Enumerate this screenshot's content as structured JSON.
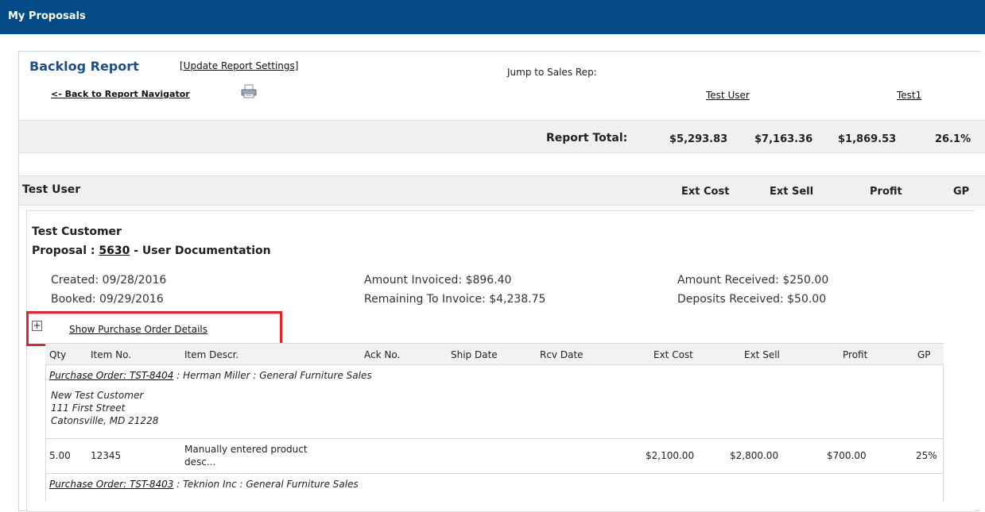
{
  "header": {
    "title": "My Proposals"
  },
  "report": {
    "title": "Backlog Report",
    "update_settings": "[Update Report Settings]",
    "back_link": "<- Back to Report Navigator",
    "jump_label": "Jump to Sales Rep:",
    "reps": [
      "Test User",
      "Test1"
    ],
    "total_label": "Report Total:",
    "totals": [
      "$5,293.83",
      "$7,163.36",
      "$1,869.53",
      "26.1%"
    ]
  },
  "user_section": {
    "name": "Test User",
    "columns": [
      "Ext Cost",
      "Ext Sell",
      "Profit",
      "GP"
    ]
  },
  "customer": {
    "name": "Test Customer",
    "proposal_prefix": "Proposal : ",
    "proposal_number": "5630",
    "proposal_suffix": " - User Documentation",
    "created": "Created: 09/28/2016",
    "booked": "Booked: 09/29/2016",
    "amount_invoiced": "Amount Invoiced: $896.40",
    "remaining_to_invoice": "Remaining To Invoice: $4,238.75",
    "amount_received": "Amount Received: $250.00",
    "deposits_received": "Deposits Received: $50.00",
    "show_po_details": "Show Purchase Order Details"
  },
  "po_table": {
    "headers": [
      "Qty",
      "Item No.",
      "Item Descr.",
      "Ack No.",
      "Ship Date",
      "Rcv Date",
      "Ext Cost",
      "Ext Sell",
      "Profit",
      "GP"
    ],
    "po1": {
      "link": "Purchase Order: TST-8404",
      "rest": " : Herman Miller : General Furniture Sales",
      "address": [
        "New Test Customer",
        "111 First Street",
        "Catonsville, MD 21228"
      ]
    },
    "row1": {
      "qty": "5.00",
      "item_no": "12345",
      "descr_line1": "Manually entered product",
      "descr_line2": "desc...",
      "ext_cost": "$2,100.00",
      "ext_sell": "$2,800.00",
      "profit": "$700.00",
      "gp": "25%"
    },
    "po2": {
      "link": "Purchase Order: TST-8403",
      "rest": " : Teknion Inc : General Furniture Sales"
    }
  },
  "icons": {
    "print": "printer-icon",
    "expand": "plus-box-icon"
  }
}
